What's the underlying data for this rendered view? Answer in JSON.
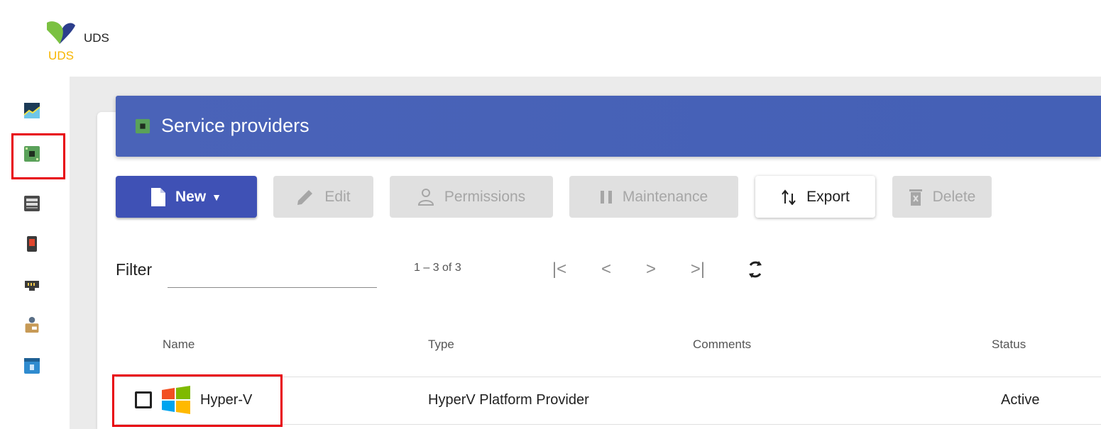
{
  "app": {
    "title": "UDS",
    "logo_text": "UDS"
  },
  "sidebar": {
    "items": [
      {
        "icon": "dashboard-chart-icon"
      },
      {
        "icon": "service-providers-chip-icon",
        "selected": true
      },
      {
        "icon": "server-icon"
      },
      {
        "icon": "red-device-icon"
      },
      {
        "icon": "network-connector-icon"
      },
      {
        "icon": "user-box-icon"
      },
      {
        "icon": "calendar-grid-icon"
      }
    ]
  },
  "header": {
    "title": "Service providers"
  },
  "toolbar": {
    "new_label": "New",
    "edit_label": "Edit",
    "permissions_label": "Permissions",
    "maintenance_label": "Maintenance",
    "export_label": "Export",
    "delete_label": "Delete"
  },
  "filter": {
    "label": "Filter",
    "value": ""
  },
  "pagination": {
    "range": "1 – 3 of 3"
  },
  "table": {
    "columns": [
      "Name",
      "Type",
      "Comments",
      "Status"
    ],
    "rows": [
      {
        "name": "Hyper-V",
        "type": "HyperV Platform Provider",
        "comments": "",
        "status": "Active"
      }
    ]
  },
  "colors": {
    "accent": "#3f51b5",
    "header": "#4a63b8",
    "highlight": "#e8000b"
  }
}
